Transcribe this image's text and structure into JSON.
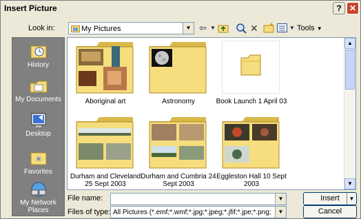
{
  "window": {
    "title": "Insert Picture",
    "help_glyph": "?",
    "close_glyph": "✕"
  },
  "toolbar": {
    "lookin_label": "Look in:",
    "lookin_value": "My Pictures",
    "tools_label": "Tools",
    "icons": [
      "back-icon",
      "up-folder-icon",
      "search-web-icon",
      "delete-icon",
      "new-folder-icon",
      "views-icon"
    ]
  },
  "places": [
    {
      "label": "History",
      "icon": "history-icon"
    },
    {
      "label": "My Documents",
      "icon": "my-documents-icon"
    },
    {
      "label": "Desktop",
      "icon": "desktop-icon"
    },
    {
      "label": "Favorites",
      "icon": "favorites-icon"
    },
    {
      "label": "My Network Places",
      "icon": "network-icon"
    }
  ],
  "folders": [
    {
      "name": "Aboriginal art",
      "kind": "photos"
    },
    {
      "name": "Astronomy",
      "kind": "moon"
    },
    {
      "name": "Book Launch 1 April 03",
      "kind": "empty"
    },
    {
      "name": "Durham and Cleveland 25 Sept 2003",
      "kind": "photos"
    },
    {
      "name": "Durham and Cumbria 24 Sept 2003",
      "kind": "photos"
    },
    {
      "name": "Eggleston Hall 10 Sept 2003",
      "kind": "photos"
    }
  ],
  "footer": {
    "filename_label": "File name:",
    "filename_value": "",
    "filetype_label": "Files of type:",
    "filetype_value": "All Pictures (*.emf;*.wmf;*.jpg;*.jpeg;*.jfif;*.jpe;*.png;",
    "insert_label": "Insert",
    "cancel_label": "Cancel"
  },
  "colors": {
    "folder": "#f6dd7e",
    "folder_dark": "#d9b84a",
    "places_bg": "#808080",
    "close": "#c9462c"
  }
}
